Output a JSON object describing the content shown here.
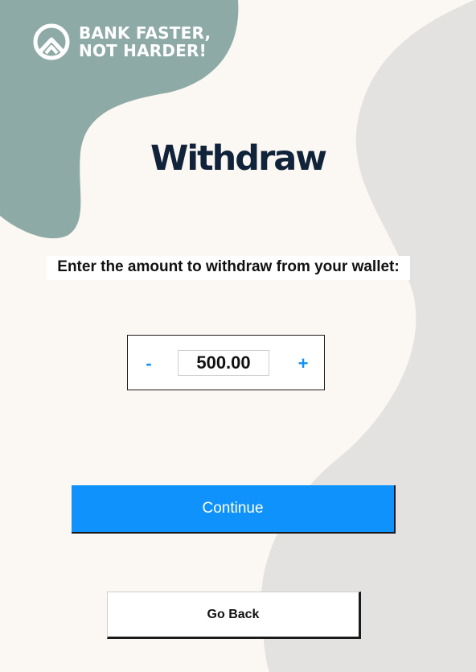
{
  "brand": {
    "logo_icon": "mountain-peak-circle-icon",
    "line1": "BANK FASTER,",
    "line2": "NOT HARDER!"
  },
  "title": "Withdraw",
  "prompt": "Enter the amount to withdraw from your wallet:",
  "stepper": {
    "minus_label": "-",
    "plus_label": "+",
    "value": "500.00"
  },
  "buttons": {
    "continue_label": "Continue",
    "go_back_label": "Go Back"
  },
  "colors": {
    "background": "#fbf7f3",
    "teal_blob": "#8eaaa6",
    "gray_blob": "#e3e2e0",
    "title": "#11233a",
    "accent": "#0f92fb"
  }
}
